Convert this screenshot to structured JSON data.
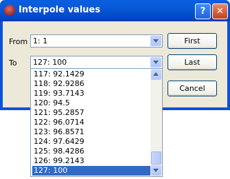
{
  "window": {
    "title": "Interpole values"
  },
  "form": {
    "from_label": "From",
    "from_value": "1: 1",
    "to_label": "To",
    "to_value": "127: 100"
  },
  "buttons": {
    "first": "First",
    "last": "Last",
    "cancel": "Cancel"
  },
  "dropdown": {
    "items": [
      "117: 92.1429",
      "118: 92.9286",
      "119: 93.7143",
      "120: 94.5",
      "121: 95.2857",
      "122: 96.0714",
      "123: 96.8571",
      "124: 97.6429",
      "125: 98.4286",
      "126: 99.2143",
      "127: 100"
    ],
    "selected_index": 10
  }
}
